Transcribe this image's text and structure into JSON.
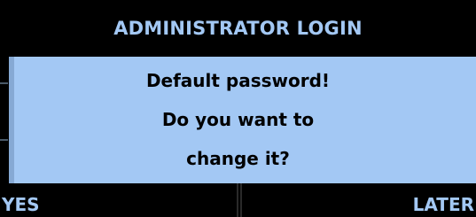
{
  "header": {
    "title": "ADMINISTRATOR LOGIN"
  },
  "dialog": {
    "lines": [
      "Default password!",
      "Do you want to",
      "change it?"
    ]
  },
  "softkeys": {
    "left_label": "YES",
    "right_label": "LATER"
  },
  "colors": {
    "background": "#000000",
    "panel": "#a3c8f4",
    "accent_text": "#a3c8f4",
    "body_text": "#000000"
  }
}
